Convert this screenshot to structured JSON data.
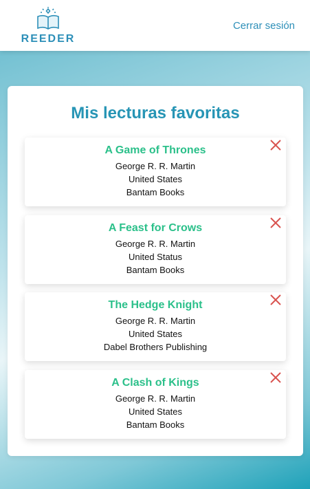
{
  "header": {
    "logo_text": "REEDER",
    "logout_label": "Cerrar sesión"
  },
  "main": {
    "title": "Mis lecturas favoritas",
    "books": [
      {
        "title": "A Game of Thrones",
        "author": "George R. R. Martin",
        "country": "United States",
        "publisher": "Bantam Books"
      },
      {
        "title": "A Feast for Crows",
        "author": "George R. R. Martin",
        "country": "United Status",
        "publisher": "Bantam Books"
      },
      {
        "title": "The Hedge Knight",
        "author": "George R. R. Martin",
        "country": "United States",
        "publisher": "Dabel Brothers Publishing"
      },
      {
        "title": "A Clash of Kings",
        "author": "George R. R. Martin",
        "country": "United States",
        "publisher": "Bantam Books"
      }
    ]
  },
  "icons": {
    "remove": "close-x-icon",
    "logo": "book-diamond-icon"
  },
  "colors": {
    "accent": "#2d8fb8",
    "book_title": "#2bc08a",
    "remove": "#d9534f"
  }
}
